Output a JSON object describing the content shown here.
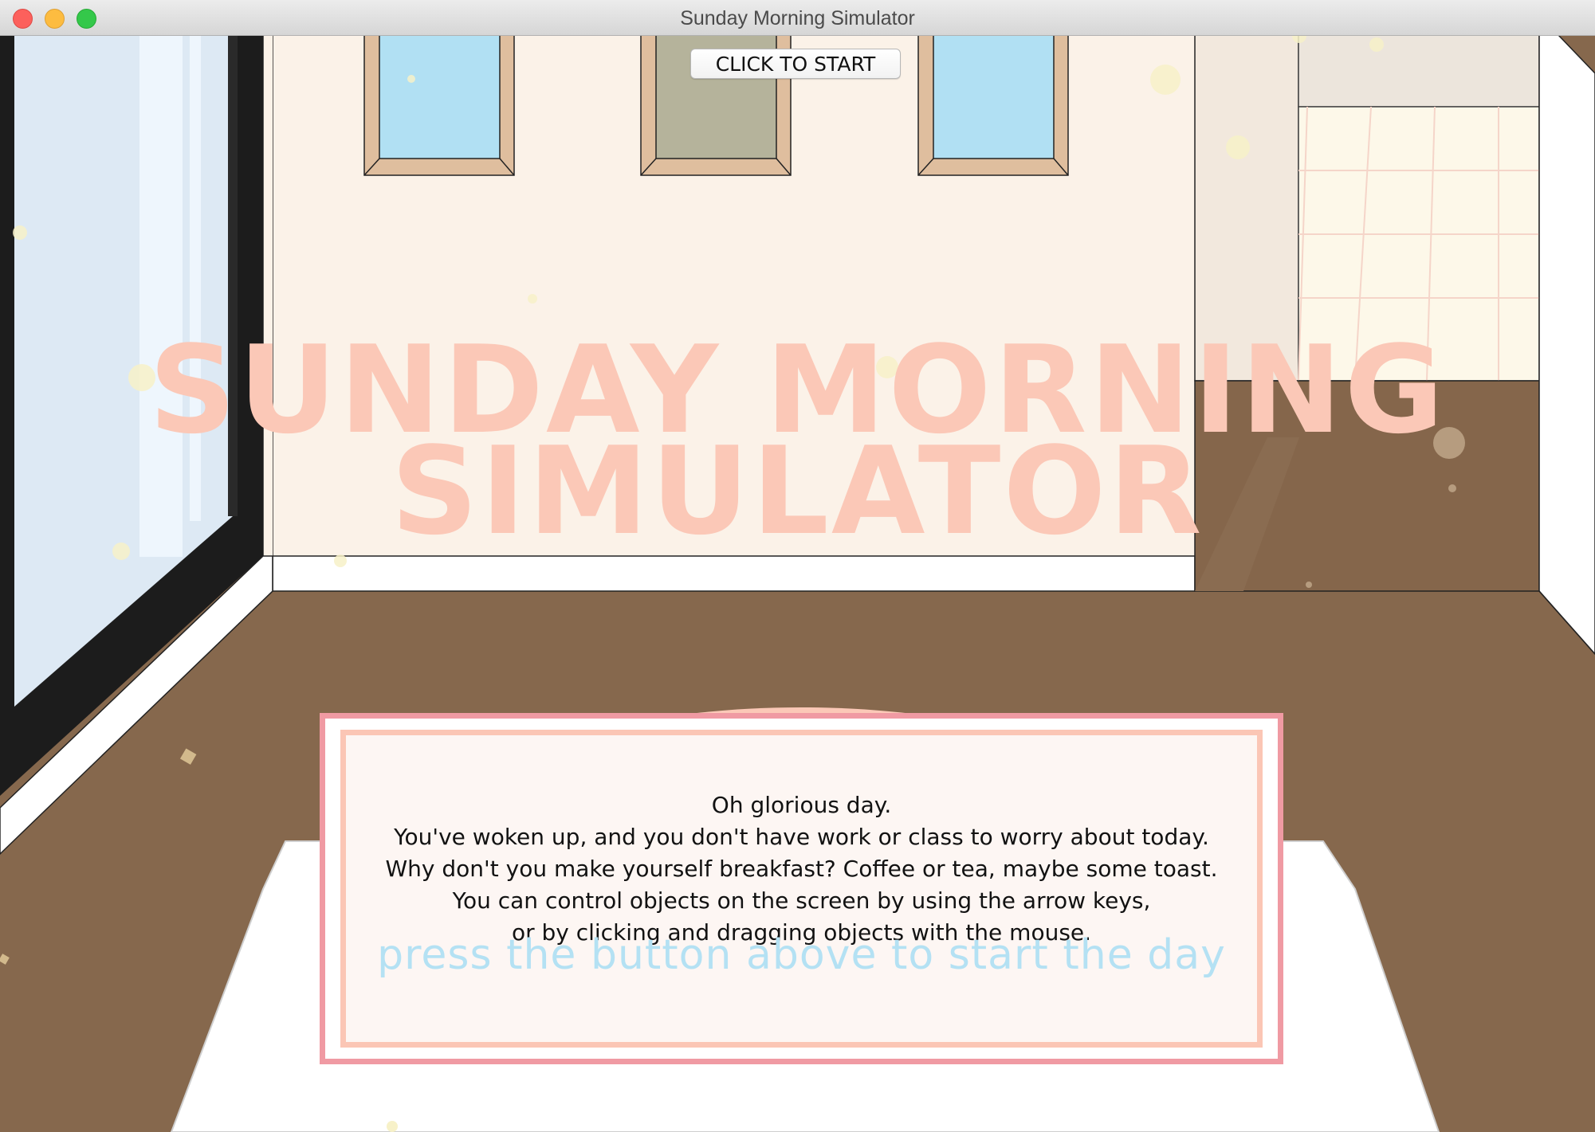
{
  "window": {
    "title": "Sunday Morning Simulator"
  },
  "game": {
    "title_line1": "SUNDAY MORNING",
    "title_line2": "SIMULATOR",
    "start_button": "CLICK TO START",
    "message_lines": [
      "Oh glorious day.",
      "You've woken up, and you don't have work or class to worry about today.",
      "Why don't you make yourself breakfast? Coffee or tea, maybe some toast.",
      "You can control objects on the screen by using the arrow keys,",
      "or by clicking and dragging objects with the mouse."
    ],
    "hint": "press the button above to start the day"
  },
  "colors": {
    "floor": "#86684d",
    "wall": "#fbf2e8",
    "title_overlay": "#fbc8b7",
    "dialog_outer_border": "#f09aa3",
    "dialog_inner_border": "#fbc6b5",
    "hint_text": "#b4e1f3",
    "frame_wood": "#dfbe9e",
    "sky": "#b1e0f3"
  }
}
